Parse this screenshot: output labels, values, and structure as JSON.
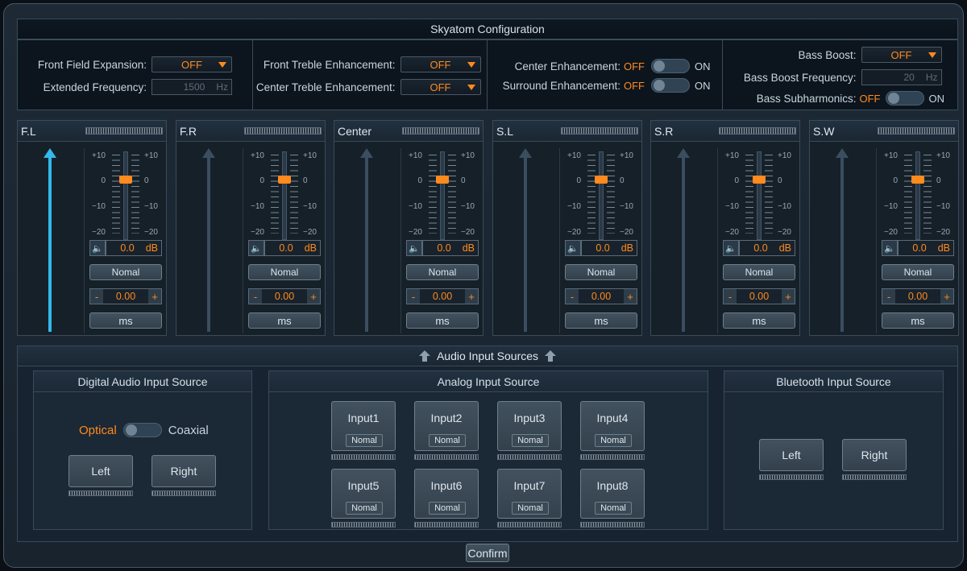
{
  "window_title": "Skyatom Configuration",
  "config": {
    "front_field_expansion": {
      "label": "Front Field Expansion:",
      "value": "OFF"
    },
    "extended_frequency": {
      "label": "Extended Frequency:",
      "value": "1500",
      "unit": "Hz"
    },
    "front_treble": {
      "label": "Front Treble Enhancement:",
      "value": "OFF"
    },
    "center_treble": {
      "label": "Center Treble Enhancement:",
      "value": "OFF"
    },
    "center_enh": {
      "label": "Center Enhancement:",
      "off": "OFF",
      "on": "ON"
    },
    "surround_enh": {
      "label": "Surround Enhancement:",
      "off": "OFF",
      "on": "ON"
    },
    "bass_boost": {
      "label": "Bass Boost:",
      "value": "OFF"
    },
    "bass_boost_freq": {
      "label": "Bass Boost Frequency:",
      "value": "20",
      "unit": "Hz"
    },
    "bass_subharmonics": {
      "label": "Bass Subharmonics:",
      "off": "OFF",
      "on": "ON"
    }
  },
  "scale": {
    "plus10": "+10",
    "zero": "0",
    "minus10": "−10",
    "minus20": "−20"
  },
  "channels": [
    {
      "name": "F.L",
      "level": "0.0",
      "unit": "dB",
      "mode": "Nomal",
      "minus": "-",
      "plus": "+",
      "delay": "0.00",
      "delay_unit": "ms"
    },
    {
      "name": "F.R",
      "level": "0.0",
      "unit": "dB",
      "mode": "Nomal",
      "minus": "-",
      "plus": "+",
      "delay": "0.00",
      "delay_unit": "ms"
    },
    {
      "name": "Center",
      "level": "0.0",
      "unit": "dB",
      "mode": "Nomal",
      "minus": "-",
      "plus": "+",
      "delay": "0.00",
      "delay_unit": "ms"
    },
    {
      "name": "S.L",
      "level": "0.0",
      "unit": "dB",
      "mode": "Nomal",
      "minus": "-",
      "plus": "+",
      "delay": "0.00",
      "delay_unit": "ms"
    },
    {
      "name": "S.R",
      "level": "0.0",
      "unit": "dB",
      "mode": "Nomal",
      "minus": "-",
      "plus": "+",
      "delay": "0.00",
      "delay_unit": "ms"
    },
    {
      "name": "S.W",
      "level": "0.0",
      "unit": "dB",
      "mode": "Nomal",
      "minus": "-",
      "plus": "+",
      "delay": "0.00",
      "delay_unit": "ms"
    }
  ],
  "sources": {
    "title": "Audio Input Sources",
    "digital": {
      "title": "Digital Audio Input Source",
      "optical": "Optical",
      "coaxial": "Coaxial",
      "left": "Left",
      "right": "Right"
    },
    "analog": {
      "title": "Analog Input Source",
      "inputs": [
        {
          "label": "Input1",
          "mode": "Nomal"
        },
        {
          "label": "Input2",
          "mode": "Nomal"
        },
        {
          "label": "Input3",
          "mode": "Nomal"
        },
        {
          "label": "Input4",
          "mode": "Nomal"
        },
        {
          "label": "Input5",
          "mode": "Nomal"
        },
        {
          "label": "Input6",
          "mode": "Nomal"
        },
        {
          "label": "Input7",
          "mode": "Nomal"
        },
        {
          "label": "Input8",
          "mode": "Nomal"
        }
      ]
    },
    "bluetooth": {
      "title": "Bluetooth Input Source",
      "left": "Left",
      "right": "Right"
    }
  },
  "confirm_label": "Confirm",
  "colors": {
    "accent": "#ff8a1e",
    "active_channel": "#35b8ea"
  }
}
